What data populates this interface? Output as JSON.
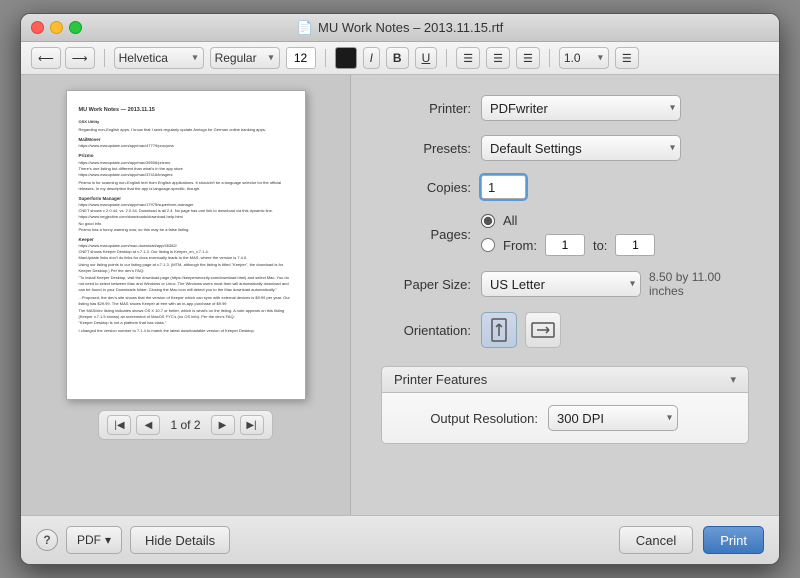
{
  "window": {
    "title": "MU Work Notes – 2013.11.15.rtf",
    "doc_icon": "📄"
  },
  "toolbar": {
    "undo_label": "↩",
    "redo_label": "↪",
    "font_label": "Helvetica",
    "style_label": "Regular",
    "size_label": "12",
    "bold_label": "B",
    "italic_label": "I",
    "underline_label": "U",
    "align_left": "≡",
    "align_center": "≡",
    "align_right": "≡",
    "spacing_label": "1.0",
    "list_label": "≡"
  },
  "preview": {
    "title": "MU Work Notes — 2013.11.15",
    "page_current": "1",
    "page_total": "2",
    "page_info": "1 of 2"
  },
  "print_settings": {
    "printer_label": "Printer:",
    "printer_value": "PDFwriter",
    "presets_label": "Presets:",
    "presets_value": "Default Settings",
    "copies_label": "Copies:",
    "copies_value": "1",
    "pages_label": "Pages:",
    "pages_all_label": "All",
    "pages_from_label": "From:",
    "pages_from_value": "1",
    "pages_to_label": "to:",
    "pages_to_value": "1",
    "paper_size_label": "Paper Size:",
    "paper_size_value": "US Letter",
    "paper_dimensions": "8.50 by 11.00 inches",
    "orientation_label": "Orientation:",
    "orientation_portrait_icon": "↑",
    "orientation_landscape_icon": "→",
    "features_label": "Printer Features",
    "output_resolution_label": "Output Resolution:",
    "output_resolution_value": "300 DPI"
  },
  "bottom_bar": {
    "help_label": "?",
    "pdf_label": "PDF",
    "pdf_arrow": "▾",
    "hide_details_label": "Hide Details",
    "cancel_label": "Cancel",
    "print_label": "Print"
  }
}
